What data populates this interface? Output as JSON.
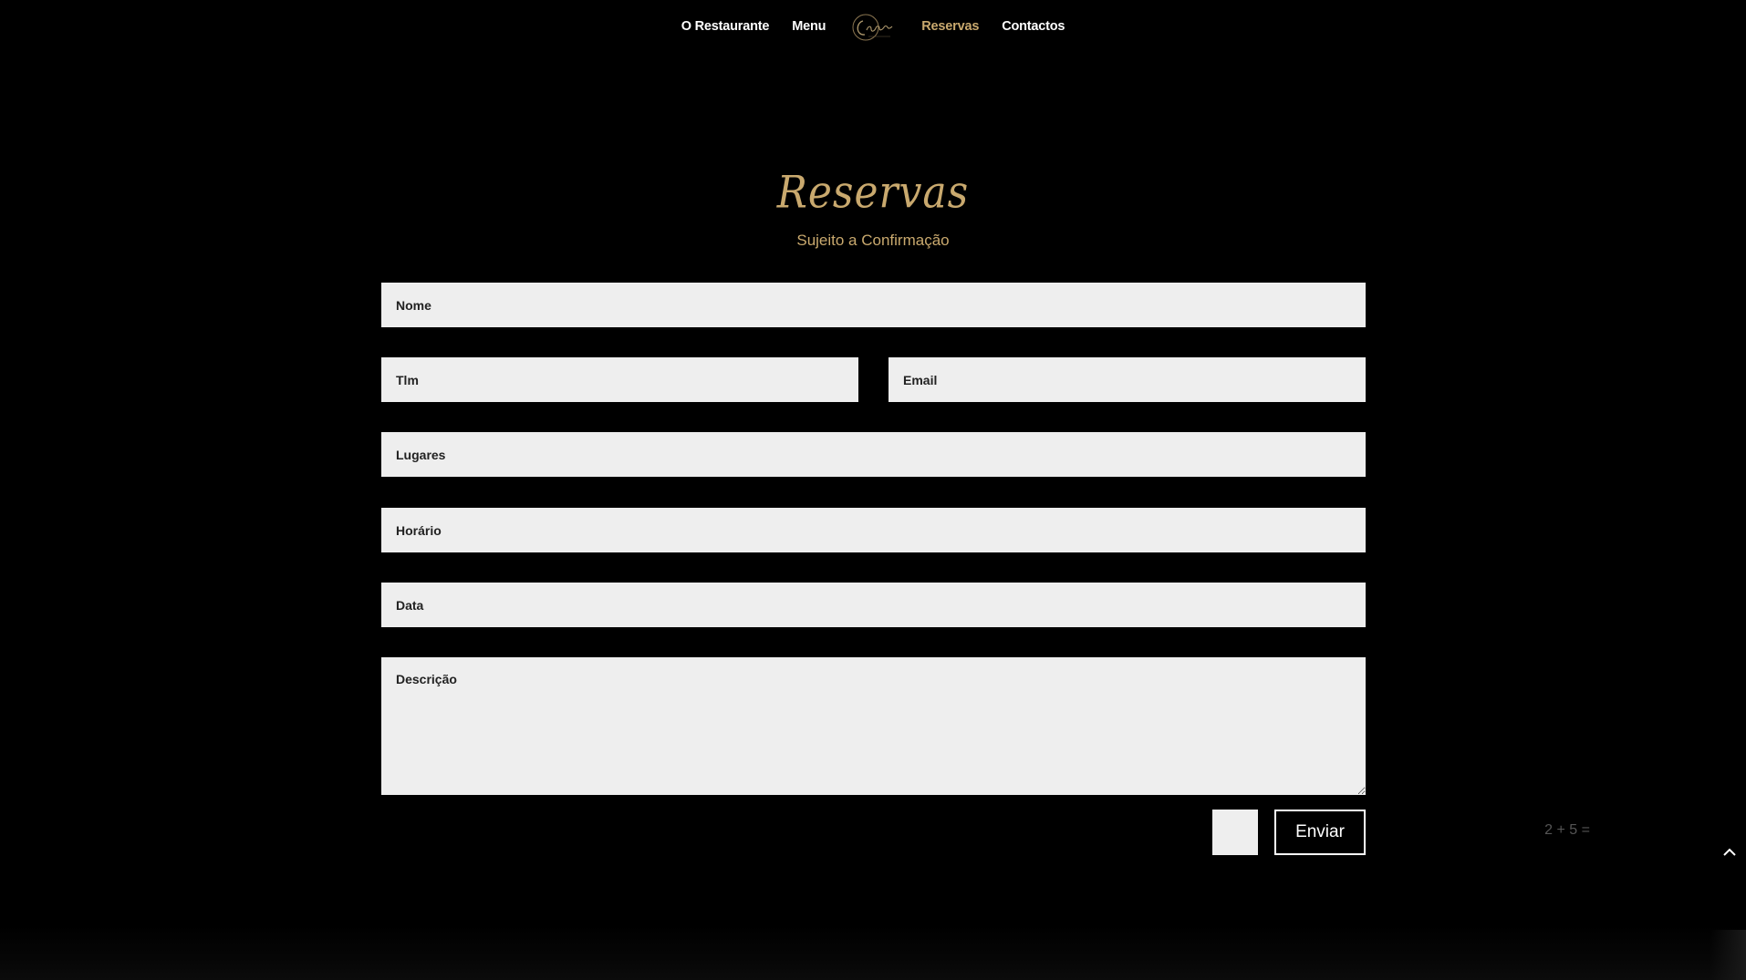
{
  "nav": {
    "items": [
      {
        "label": "O Restaurante",
        "active": false
      },
      {
        "label": "Menu",
        "active": false
      },
      {
        "label": "Reservas",
        "active": true
      },
      {
        "label": "Contactos",
        "active": false
      }
    ],
    "logo_icon": "restaurant-script-logo"
  },
  "heading": {
    "title": "Reservas",
    "subtitle": "Sujeito a Confirmação"
  },
  "form": {
    "name_placeholder": "Nome",
    "phone_placeholder": "Tlm",
    "email_placeholder": "Email",
    "seats_placeholder": "Lugares",
    "time_placeholder": "Horário",
    "date_placeholder": "Data",
    "description_placeholder": "Descrição",
    "captcha_question": "2 + 5 =",
    "captcha_value": "",
    "submit_label": "Enviar"
  },
  "back_to_top_icon": "chevron-up-icon",
  "colors": {
    "background": "#000000",
    "accent_gold": "#c9a96e",
    "field_background": "#eeeeee",
    "nav_text": "#ffffff"
  }
}
